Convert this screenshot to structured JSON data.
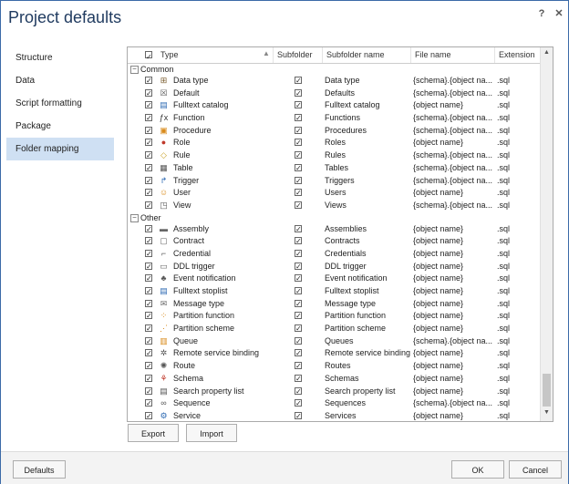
{
  "window": {
    "title": "Project defaults",
    "help_label": "?",
    "close_label": "✕"
  },
  "sidebar": {
    "items": [
      {
        "label": "Structure",
        "active": false
      },
      {
        "label": "Data",
        "active": false
      },
      {
        "label": "Script formatting",
        "active": false
      },
      {
        "label": "Package",
        "active": false
      },
      {
        "label": "Folder mapping",
        "active": true
      }
    ]
  },
  "grid": {
    "headers": {
      "type": "Type",
      "subfolder": "Subfolder",
      "subfolder_name": "Subfolder name",
      "file_name": "File name",
      "extension": "Extension"
    },
    "groups": [
      {
        "name": "Common",
        "toggle": "−",
        "rows": [
          {
            "type": "Data type",
            "icon": "data-type-icon",
            "glyph": "⊞",
            "color": "#7a5c2e",
            "subfolder": "Data type",
            "file": "{schema}.{object na...",
            "ext": ".sql"
          },
          {
            "type": "Default",
            "icon": "default-icon",
            "glyph": "☒",
            "color": "#555555",
            "subfolder": "Defaults",
            "file": "{schema}.{object na...",
            "ext": ".sql"
          },
          {
            "type": "Fulltext catalog",
            "icon": "fulltext-catalog-icon",
            "glyph": "▤",
            "color": "#2f6bb3",
            "subfolder": "Fulltext catalog",
            "file": "{object name}",
            "ext": ".sql"
          },
          {
            "type": "Function",
            "icon": "function-icon",
            "glyph": "ƒx",
            "color": "#333333",
            "subfolder": "Functions",
            "file": "{schema}.{object na...",
            "ext": ".sql"
          },
          {
            "type": "Procedure",
            "icon": "procedure-icon",
            "glyph": "▣",
            "color": "#d98b1c",
            "subfolder": "Procedures",
            "file": "{schema}.{object na...",
            "ext": ".sql"
          },
          {
            "type": "Role",
            "icon": "role-icon",
            "glyph": "●",
            "color": "#c0392b",
            "subfolder": "Roles",
            "file": "{object name}",
            "ext": ".sql"
          },
          {
            "type": "Rule",
            "icon": "rule-icon",
            "glyph": "◇",
            "color": "#c9a227",
            "subfolder": "Rules",
            "file": "{schema}.{object na...",
            "ext": ".sql"
          },
          {
            "type": "Table",
            "icon": "table-icon",
            "glyph": "▦",
            "color": "#555555",
            "subfolder": "Tables",
            "file": "{schema}.{object na...",
            "ext": ".sql"
          },
          {
            "type": "Trigger",
            "icon": "trigger-icon",
            "glyph": "↱",
            "color": "#2f6bb3",
            "subfolder": "Triggers",
            "file": "{schema}.{object na...",
            "ext": ".sql"
          },
          {
            "type": "User",
            "icon": "user-icon",
            "glyph": "☺",
            "color": "#d98b1c",
            "subfolder": "Users",
            "file": "{object name}",
            "ext": ".sql"
          },
          {
            "type": "View",
            "icon": "view-icon",
            "glyph": "◳",
            "color": "#555555",
            "subfolder": "Views",
            "file": "{schema}.{object na...",
            "ext": ".sql"
          }
        ]
      },
      {
        "name": "Other",
        "toggle": "−",
        "rows": [
          {
            "type": "Assembly",
            "icon": "assembly-icon",
            "glyph": "▬",
            "color": "#666666",
            "subfolder": "Assemblies",
            "file": "{object name}",
            "ext": ".sql"
          },
          {
            "type": "Contract",
            "icon": "contract-icon",
            "glyph": "▢",
            "color": "#666666",
            "subfolder": "Contracts",
            "file": "{object name}",
            "ext": ".sql"
          },
          {
            "type": "Credential",
            "icon": "credential-icon",
            "glyph": "⌐",
            "color": "#666666",
            "subfolder": "Credentials",
            "file": "{object name}",
            "ext": ".sql"
          },
          {
            "type": "DDL trigger",
            "icon": "ddl-trigger-icon",
            "glyph": "▭",
            "color": "#666666",
            "subfolder": "DDL trigger",
            "file": "{object name}",
            "ext": ".sql"
          },
          {
            "type": "Event notification",
            "icon": "event-notification-icon",
            "glyph": "♣",
            "color": "#555555",
            "subfolder": "Event notification",
            "file": "{object name}",
            "ext": ".sql"
          },
          {
            "type": "Fulltext stoplist",
            "icon": "fulltext-stoplist-icon",
            "glyph": "▤",
            "color": "#2f6bb3",
            "subfolder": "Fulltext stoplist",
            "file": "{object name}",
            "ext": ".sql"
          },
          {
            "type": "Message type",
            "icon": "message-type-icon",
            "glyph": "✉",
            "color": "#666666",
            "subfolder": "Message type",
            "file": "{object name}",
            "ext": ".sql"
          },
          {
            "type": "Partition function",
            "icon": "partition-function-icon",
            "glyph": "⁘",
            "color": "#d98b1c",
            "subfolder": "Partition function",
            "file": "{object name}",
            "ext": ".sql"
          },
          {
            "type": "Partition scheme",
            "icon": "partition-scheme-icon",
            "glyph": "⋰",
            "color": "#d98b1c",
            "subfolder": "Partition scheme",
            "file": "{object name}",
            "ext": ".sql"
          },
          {
            "type": "Queue",
            "icon": "queue-icon",
            "glyph": "▥",
            "color": "#d98b1c",
            "subfolder": "Queues",
            "file": "{schema}.{object na...",
            "ext": ".sql"
          },
          {
            "type": "Remote service binding",
            "icon": "remote-service-binding-icon",
            "glyph": "✲",
            "color": "#555555",
            "subfolder": "Remote service binding",
            "file": "{object name}",
            "ext": ".sql"
          },
          {
            "type": "Route",
            "icon": "route-icon",
            "glyph": "✺",
            "color": "#555555",
            "subfolder": "Routes",
            "file": "{object name}",
            "ext": ".sql"
          },
          {
            "type": "Schema",
            "icon": "schema-icon",
            "glyph": "⚘",
            "color": "#c0392b",
            "subfolder": "Schemas",
            "file": "{object name}",
            "ext": ".sql"
          },
          {
            "type": "Search property list",
            "icon": "search-property-list-icon",
            "glyph": "▤",
            "color": "#555555",
            "subfolder": "Search property list",
            "file": "{object name}",
            "ext": ".sql"
          },
          {
            "type": "Sequence",
            "icon": "sequence-icon",
            "glyph": "∞",
            "color": "#555555",
            "subfolder": "Sequences",
            "file": "{schema}.{object na...",
            "ext": ".sql"
          },
          {
            "type": "Service",
            "icon": "service-icon",
            "glyph": "⚙",
            "color": "#2f6bb3",
            "subfolder": "Services",
            "file": "{object name}",
            "ext": ".sql"
          }
        ]
      }
    ]
  },
  "buttons": {
    "export": "Export",
    "import": "Import",
    "defaults": "Defaults",
    "ok": "OK",
    "cancel": "Cancel"
  }
}
